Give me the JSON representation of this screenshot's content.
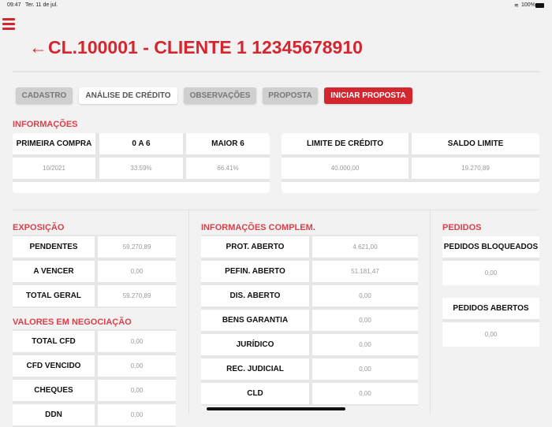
{
  "status_bar": {
    "time": "09:47",
    "date": "Ter. 11 de jul.",
    "battery": "100%"
  },
  "header": {
    "title": "CL.100001 - CLIENTE 1 12345678910",
    "back_icon": "arrow-left-icon",
    "menu_icon": "hamburger-icon"
  },
  "tabs": [
    {
      "label": "CADASTRO"
    },
    {
      "label": "ANÁLISE DE CRÉDITO"
    },
    {
      "label": "OBSERVAÇÕES"
    },
    {
      "label": "PROPOSTA"
    },
    {
      "label": "INICIAR PROPOSTA"
    }
  ],
  "informacoes": {
    "title": "INFORMAÇÕES",
    "left": [
      {
        "label": "PRIMEIRA COMPRA",
        "value": "10/2021"
      },
      {
        "label": "0 A 6",
        "value": "33.59%"
      },
      {
        "label": "MAIOR 6",
        "value": "66.41%"
      }
    ],
    "right": [
      {
        "label": "LIMITE DE CRÉDITO",
        "value": "40.000,00"
      },
      {
        "label": "SALDO LIMITE",
        "value": "19.270,89"
      }
    ]
  },
  "exposicao": {
    "title": "EXPOSIÇÃO",
    "rows": [
      {
        "label": "PENDENTES",
        "value": "59.270,89"
      },
      {
        "label": "A VENCER",
        "value": "0,00"
      },
      {
        "label": "TOTAL GERAL",
        "value": "59.270,89"
      }
    ]
  },
  "negociacao": {
    "title": "VALORES EM NEGOCIAÇÃO",
    "rows": [
      {
        "label": "TOTAL CFD",
        "value": "0,00"
      },
      {
        "label": "CFD VENCIDO",
        "value": "0,00"
      },
      {
        "label": "CHEQUES",
        "value": "0,00"
      },
      {
        "label": "DDN",
        "value": "0,00"
      }
    ]
  },
  "complem": {
    "title": "INFORMAÇÕES COMPLEM.",
    "rows": [
      {
        "label": "PROT. ABERTO",
        "value": "4.621,00"
      },
      {
        "label": "PEFIN. ABERTO",
        "value": "51.181,47"
      },
      {
        "label": "DIS. ABERTO",
        "value": "0,00"
      },
      {
        "label": "BENS GARANTIA",
        "value": "0,00"
      },
      {
        "label": "JURÍDICO",
        "value": "0,00"
      },
      {
        "label": "REC. JUDICIAL",
        "value": "0,00"
      },
      {
        "label": "CLD",
        "value": "0,00"
      }
    ]
  },
  "pedidos": {
    "title": "PEDIDOS",
    "cards": [
      {
        "label": "PEDIDOS BLOQUEADOS",
        "value": "0,00"
      },
      {
        "label": "PEDIDOS ABERTOS",
        "value": "0,00"
      }
    ]
  }
}
